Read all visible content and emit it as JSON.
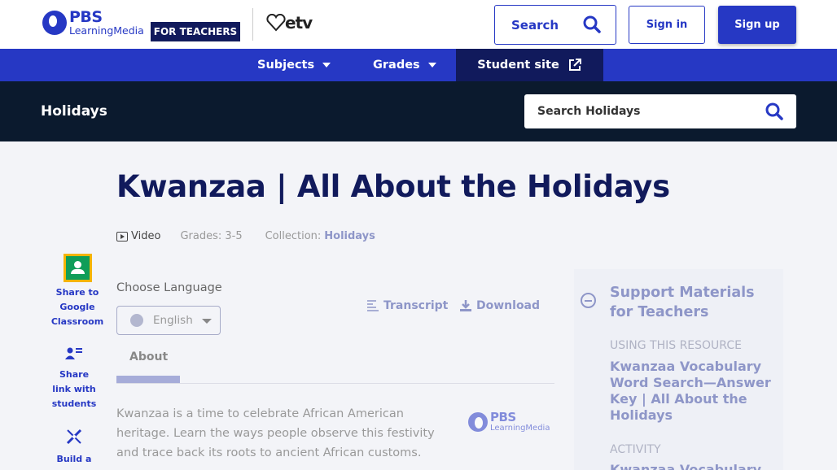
{
  "header": {
    "logo_pbs": "PBS",
    "logo_lm": "LearningMedia",
    "for_teachers": "FOR TEACHERS",
    "etv": "etv",
    "search_label": "Search",
    "signin_label": "Sign in",
    "signup_label": "Sign up"
  },
  "nav": {
    "subjects": "Subjects",
    "grades": "Grades",
    "student_site": "Student site"
  },
  "band": {
    "title": "Holidays",
    "search_placeholder": "Search Holidays"
  },
  "main": {
    "title": "Kwanzaa | All About the Holidays",
    "type": "Video",
    "grades": "Grades: 3-5",
    "collection_label": "Collection:",
    "collection_link": "Holidays",
    "choose_language": "Choose Language",
    "language": "English",
    "transcript": "Transcript",
    "download": "Download",
    "about_tab": "About",
    "about_text": "Kwanzaa is a time to celebrate African American heritage. Learn the ways people observe this festivity and trace back its roots to ancient African customs."
  },
  "share": {
    "google_classroom": "Share to Google Classroom",
    "share_link": "Share link with students",
    "build": "Build a"
  },
  "panel": {
    "title": "Support Materials for Teachers",
    "label1": "Using this resource",
    "link1": "Kwanzaa Vocabulary Word Search—Answer Key | All About the Holidays",
    "label2": "Activity",
    "link2": "Kwanzaa Vocabulary"
  },
  "colors": {
    "primary": "#2638c4",
    "dark_navy": "#111a5c",
    "band": "#0b1a2e",
    "muted_link": "#8e96c8"
  }
}
